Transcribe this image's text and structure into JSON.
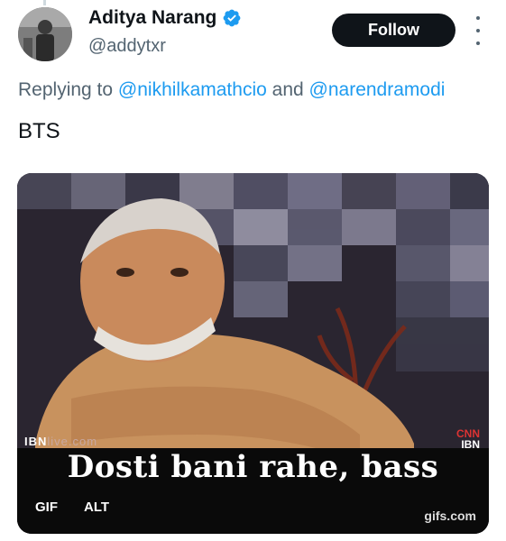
{
  "author": {
    "name": "Aditya Narang",
    "handle": "@addytxr",
    "verified": true
  },
  "follow_label": "Follow",
  "reply_context": {
    "prefix": "Replying to",
    "mentions": [
      "@nikhilkamathcio",
      "@narendramodi"
    ],
    "joiner": "and"
  },
  "tweet_text": "BTS",
  "media": {
    "caption": "Dosti bani rahe, bass",
    "gif_badge": "GIF",
    "alt_badge": "ALT",
    "watermark": "gifs.com",
    "channel_left": "IBN",
    "channel_left_suffix": "live.com",
    "channel_right_top": "CNN",
    "channel_right_bottom": "IBN"
  },
  "colors": {
    "accent": "#1d9bf0",
    "text_primary": "#0f1419",
    "text_secondary": "#536471",
    "button_bg": "#0f1419"
  },
  "icons": [
    "verified-badge-icon",
    "more-options-icon"
  ]
}
